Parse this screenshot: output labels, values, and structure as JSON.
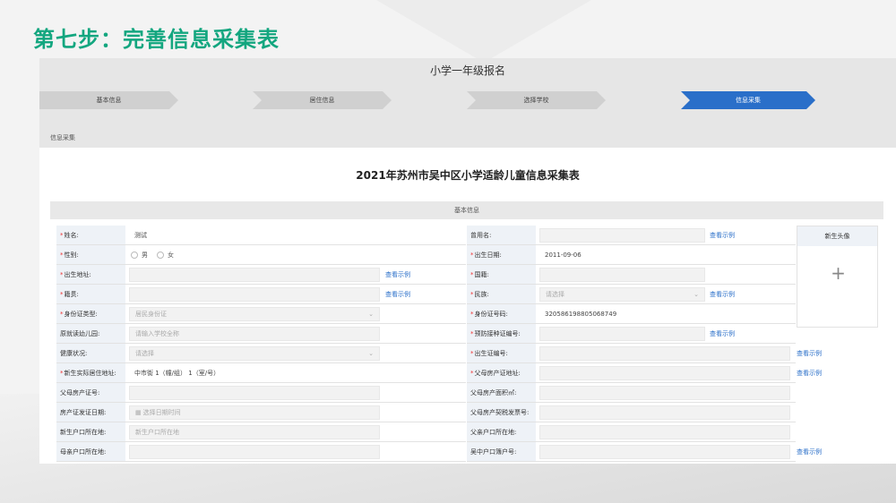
{
  "slide_title": "第七步：完善信息采集表",
  "app": {
    "title": "小学一年级报名",
    "breadcrumb": "信息采集"
  },
  "steps": [
    {
      "label": "基本信息",
      "active": false
    },
    {
      "label": "居住信息",
      "active": false
    },
    {
      "label": "选择学校",
      "active": false
    },
    {
      "label": "信息采集",
      "active": true
    }
  ],
  "form": {
    "title": "2021年苏州市吴中区小学适龄儿童信息采集表",
    "section": "基本信息",
    "photo_label": "新生头像",
    "view_example": "查看示例",
    "left": [
      {
        "label": "姓名:",
        "req": true,
        "value": "测试",
        "kind": "value"
      },
      {
        "label": "性别:",
        "req": true,
        "kind": "radio",
        "options": [
          "男",
          "女"
        ]
      },
      {
        "label": "出生地址:",
        "req": true,
        "value": "",
        "kind": "input",
        "link": true
      },
      {
        "label": "籍贯:",
        "req": true,
        "value": "",
        "kind": "input",
        "link": true
      },
      {
        "label": "身份证类型:",
        "req": true,
        "value": "居民身份证",
        "kind": "select"
      },
      {
        "label": "原就读幼儿园:",
        "req": false,
        "value": "请输入学校全称",
        "kind": "input"
      },
      {
        "label": "健康状况:",
        "req": false,
        "value": "请选择",
        "kind": "select"
      },
      {
        "label": "新生实际居住地址:",
        "req": true,
        "value": "中市街 1（幢/组） 1（室/号）",
        "kind": "value"
      },
      {
        "label": "父母房产证号:",
        "req": false,
        "value": "",
        "kind": "input"
      },
      {
        "label": "房产证发证日期:",
        "req": false,
        "value": "选择日期时间",
        "kind": "date"
      },
      {
        "label": "新生户口所在地:",
        "req": false,
        "value": "新生户口所在地",
        "kind": "input"
      },
      {
        "label": "母亲户口所在地:",
        "req": false,
        "value": "",
        "kind": "input"
      }
    ],
    "right": [
      {
        "label": "曾用名:",
        "req": false,
        "value": "",
        "kind": "input",
        "link": true
      },
      {
        "label": "出生日期:",
        "req": true,
        "value": "2011-09-06",
        "kind": "value"
      },
      {
        "label": "国籍:",
        "req": true,
        "value": "",
        "kind": "input"
      },
      {
        "label": "民族:",
        "req": true,
        "value": "请选择",
        "kind": "select",
        "link": true
      },
      {
        "label": "身份证号码:",
        "req": true,
        "value": "320586198805068749",
        "kind": "value"
      },
      {
        "label": "预防接种证编号:",
        "req": true,
        "value": "",
        "kind": "input",
        "link": true
      },
      {
        "label": "出生证编号:",
        "req": true,
        "value": "",
        "kind": "input-wide",
        "link": true
      },
      {
        "label": "父母房产证地址:",
        "req": true,
        "value": "",
        "kind": "input-wide",
        "link": true
      },
      {
        "label": "父母房产面积㎡:",
        "req": false,
        "value": "",
        "kind": "input-wide"
      },
      {
        "label": "父母房产契税发票号:",
        "req": false,
        "value": "",
        "kind": "input-wide"
      },
      {
        "label": "父亲户口所在地:",
        "req": false,
        "value": "",
        "kind": "input-wide"
      },
      {
        "label": "吴中户口簿户号:",
        "req": false,
        "value": "",
        "kind": "input-wide",
        "link": true
      }
    ]
  },
  "colors": {
    "accent": "#13a67f",
    "active_step": "#2a6fc9",
    "link": "#2a6fc9"
  }
}
